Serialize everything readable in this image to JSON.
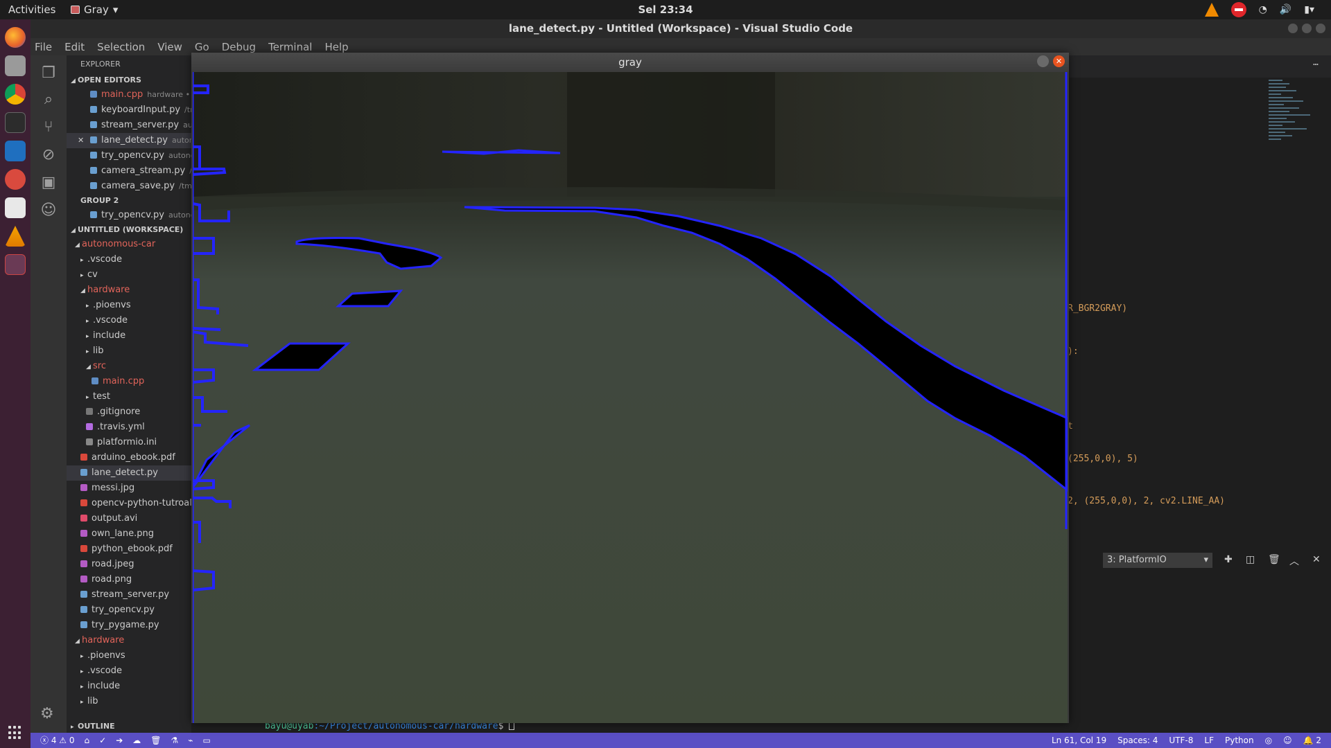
{
  "topbar": {
    "activities": "Activities",
    "app_name": "Gray",
    "clock": "Sel 23:34"
  },
  "window": {
    "title": "lane_detect.py - Untitled (Workspace) - Visual Studio Code"
  },
  "menu": [
    "File",
    "Edit",
    "Selection",
    "View",
    "Go",
    "Debug",
    "Terminal",
    "Help"
  ],
  "sidebar": {
    "header": "EXPLORER",
    "open_editors_title": "OPEN EDITORS",
    "open_editors": [
      {
        "name": "main.cpp",
        "desc": "hardware • s",
        "icon": "cpp-file-icon",
        "color": "#e2645a"
      },
      {
        "name": "keyboardInput.py",
        "desc": "/tr",
        "icon": "python-file-icon"
      },
      {
        "name": "stream_server.py",
        "desc": "aut",
        "icon": "python-file-icon"
      },
      {
        "name": "lane_detect.py",
        "desc": "auton",
        "icon": "python-file-icon",
        "selected": true
      },
      {
        "name": "try_opencv.py",
        "desc": "autono",
        "icon": "python-file-icon"
      },
      {
        "name": "camera_stream.py",
        "desc": "/t",
        "icon": "python-file-icon"
      },
      {
        "name": "camera_save.py",
        "desc": "/tmp",
        "icon": "python-file-icon"
      }
    ],
    "group2_title": "GROUP 2",
    "group2": [
      {
        "name": "try_opencv.py",
        "desc": "autono",
        "icon": "python-file-icon"
      }
    ],
    "workspace_title": "UNTITLED (WORKSPACE)",
    "tree": [
      {
        "name": "autonomous-car",
        "level": 0,
        "type": "folder-open",
        "color": "#e2645a"
      },
      {
        "name": ".vscode",
        "level": 1,
        "type": "folder"
      },
      {
        "name": "cv",
        "level": 1,
        "type": "folder"
      },
      {
        "name": "hardware",
        "level": 1,
        "type": "folder-open",
        "color": "#e2645a"
      },
      {
        "name": ".pioenvs",
        "level": 2,
        "type": "folder"
      },
      {
        "name": ".vscode",
        "level": 2,
        "type": "folder"
      },
      {
        "name": "include",
        "level": 2,
        "type": "folder"
      },
      {
        "name": "lib",
        "level": 2,
        "type": "folder"
      },
      {
        "name": "src",
        "level": 2,
        "type": "folder-open",
        "color": "#e2645a"
      },
      {
        "name": "main.cpp",
        "level": 3,
        "type": "cpp",
        "color": "#e2645a"
      },
      {
        "name": "test",
        "level": 2,
        "type": "folder"
      },
      {
        "name": ".gitignore",
        "level": 2,
        "type": "git"
      },
      {
        "name": ".travis.yml",
        "level": 2,
        "type": "yml"
      },
      {
        "name": "platformio.ini",
        "level": 2,
        "type": "ini"
      },
      {
        "name": "arduino_ebook.pdf",
        "level": 1,
        "type": "pdf"
      },
      {
        "name": "lane_detect.py",
        "level": 1,
        "type": "py",
        "selected": true
      },
      {
        "name": "messi.jpg",
        "level": 1,
        "type": "img"
      },
      {
        "name": "opencv-python-tutroals",
        "level": 1,
        "type": "pdf"
      },
      {
        "name": "output.avi",
        "level": 1,
        "type": "video"
      },
      {
        "name": "own_lane.png",
        "level": 1,
        "type": "img"
      },
      {
        "name": "python_ebook.pdf",
        "level": 1,
        "type": "pdf"
      },
      {
        "name": "road.jpeg",
        "level": 1,
        "type": "img"
      },
      {
        "name": "road.png",
        "level": 1,
        "type": "img"
      },
      {
        "name": "stream_server.py",
        "level": 1,
        "type": "py"
      },
      {
        "name": "try_opencv.py",
        "level": 1,
        "type": "py"
      },
      {
        "name": "try_pygame.py",
        "level": 1,
        "type": "py"
      },
      {
        "name": "hardware",
        "level": 0,
        "type": "folder-open",
        "color": "#e2645a"
      },
      {
        "name": ".pioenvs",
        "level": 1,
        "type": "folder"
      },
      {
        "name": ".vscode",
        "level": 1,
        "type": "folder"
      },
      {
        "name": "include",
        "level": 1,
        "type": "folder"
      },
      {
        "name": "lib",
        "level": 1,
        "type": "folder"
      }
    ],
    "outline_title": "OUTLINE"
  },
  "editor": {
    "lines": [
      {
        "text": "R_BGR2GRAY)"
      },
      {
        "text": "):"
      },
      {
        "text": "t"
      },
      {
        "text": "(255,0,0), 5)"
      },
      {
        "text": "2, (255,0,0), 2, cv2.LINE_AA)"
      }
    ]
  },
  "panel": {
    "terminal_select": "3: PlatformIO"
  },
  "terminal": {
    "prompt_user": "bayu@uyab",
    "prompt_path": ":~/Project/autonomous-car/hardware",
    "prompt_end": "$ "
  },
  "gray_window": {
    "title": "gray"
  },
  "statusbar": {
    "errors": "4",
    "warnings": "0",
    "position": "Ln 61, Col 19",
    "spaces": "Spaces: 4",
    "encoding": "UTF-8",
    "eol": "LF",
    "language": "Python",
    "notifications": "2"
  },
  "colors": {
    "accent": "#5a4fc4",
    "contour": "#1a1aff",
    "highlight": "#e2645a"
  }
}
